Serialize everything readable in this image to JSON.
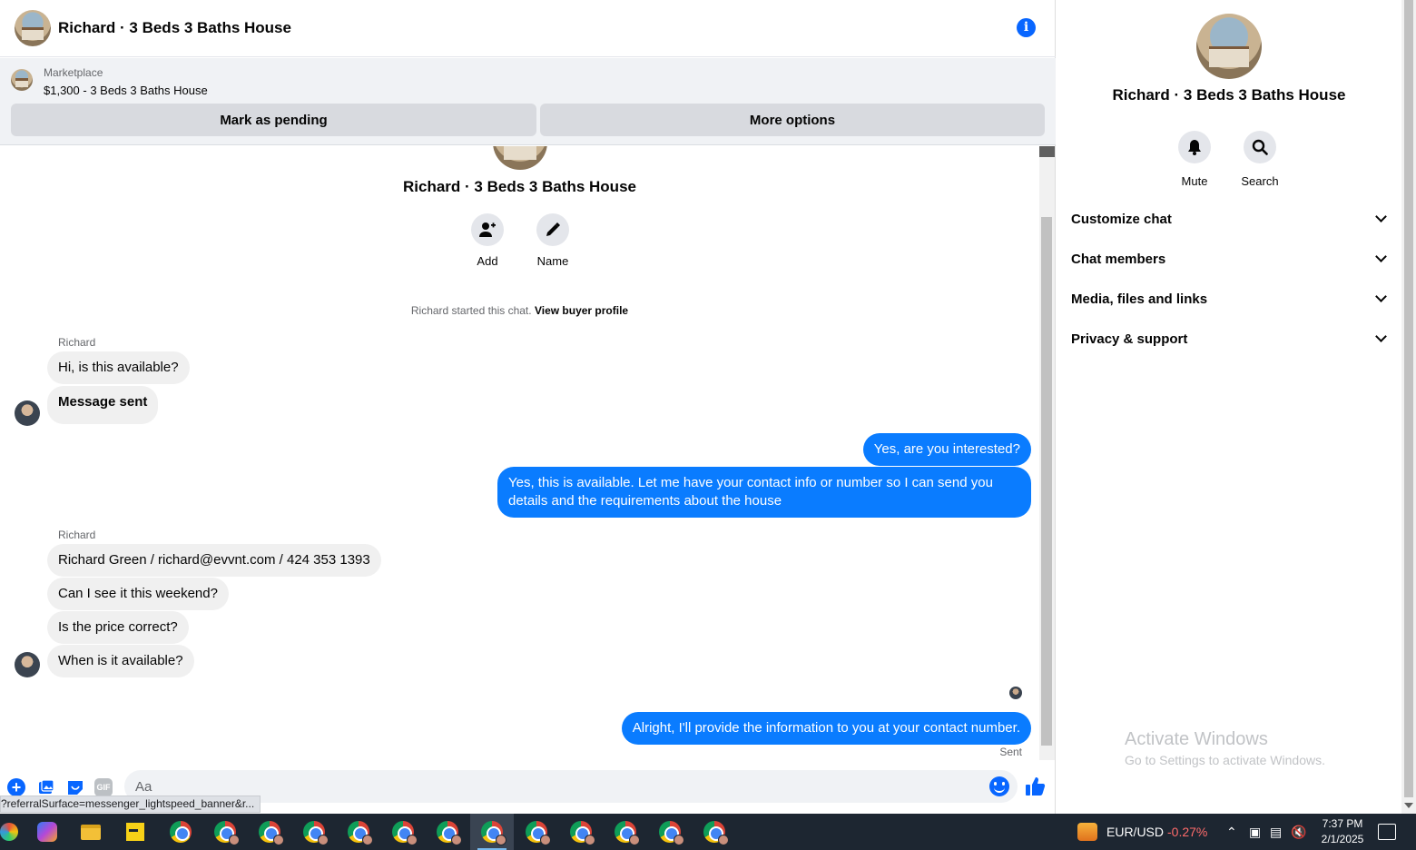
{
  "header": {
    "title": "Richard · 3 Beds 3 Baths House"
  },
  "marketplace": {
    "label": "Marketplace",
    "listing": "$1,300 - 3 Beds 3 Baths House",
    "pending_label": "Mark as pending",
    "more_label": "More options"
  },
  "intro": {
    "title": "Richard · 3 Beds 3 Baths House",
    "add_label": "Add",
    "name_label": "Name",
    "started_text": "Richard started this chat.",
    "profile_link": "View buyer profile"
  },
  "messages": {
    "sender1": "Richard",
    "m1": "Hi, is this available?",
    "m2": "Message sent",
    "o1": "Yes, are you interested?",
    "o2": "Yes, this is available. Let me have your contact info or number so I can send you details and the requirements about the house",
    "sender2": "Richard",
    "m3": "Richard Green / richard@evvnt.com / 424 353 1393",
    "m4": "Can I see it this weekend?",
    "m5": "Is the price correct?",
    "m6": "When is it available?",
    "o3": "Alright, I'll provide the information to you at your contact number.",
    "status": "Sent"
  },
  "composer": {
    "placeholder": "Aa",
    "gif_label": "GIF",
    "status_url": "?referralSurface=messenger_lightspeed_banner&r..."
  },
  "info_panel": {
    "title": "Richard · 3 Beds 3 Baths House",
    "mute_label": "Mute",
    "search_label": "Search",
    "rows": [
      "Customize chat",
      "Chat members",
      "Media, files and links",
      "Privacy & support"
    ]
  },
  "watermark": {
    "title": "Activate Windows",
    "subtitle": "Go to Settings to activate Windows."
  },
  "taskbar": {
    "fx_pair": "EUR/USD",
    "fx_change": "-0.27%",
    "time": "7:37 PM",
    "date": "2/1/2025"
  },
  "colors": {
    "accent": "#0a7cff",
    "brand": "#0866ff",
    "taskbar": "#1d2631"
  }
}
